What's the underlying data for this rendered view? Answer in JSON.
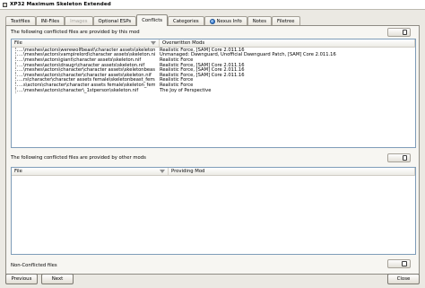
{
  "window": {
    "title": "XP32 Maximum Skeleton Extended"
  },
  "tabs": [
    {
      "label": "Textfiles",
      "disabled": false,
      "active": false
    },
    {
      "label": "INI-Files",
      "disabled": false,
      "active": false
    },
    {
      "label": "Images",
      "disabled": true,
      "active": false
    },
    {
      "label": "Optional ESPs",
      "disabled": false,
      "active": false
    },
    {
      "label": "Conflicts",
      "disabled": false,
      "active": true
    },
    {
      "label": "Categories",
      "disabled": false,
      "active": false
    },
    {
      "label": "Nexus Info",
      "disabled": false,
      "active": false,
      "icon": "globe-icon"
    },
    {
      "label": "Notes",
      "disabled": false,
      "active": false
    },
    {
      "label": "Filetree",
      "disabled": false,
      "active": false
    }
  ],
  "conflicts": {
    "provided_label": "The following conflicted files are provided by this mod",
    "provided_columns": {
      "file": "File",
      "overwritten": "Overwritten Mods"
    },
    "provided_rows": [
      {
        "file": "...\\meshes\\actors\\werewolfbeast\\character assets\\skeleton.nif",
        "mods": "Realistic Force, [SAM] Core 2.011.16"
      },
      {
        "file": "...\\meshes\\actors\\vampirelord\\character assets\\skeleton.nif",
        "mods": "Unmanaged: Dawnguard, Unofficial Dawnguard Patch, [SAM] Core 2.011.16"
      },
      {
        "file": "...\\meshes\\actors\\giant\\character assets\\skeleton.nif",
        "mods": "Realistic Force"
      },
      {
        "file": "...\\meshes\\actors\\draugr\\character assets\\skeleton.nif",
        "mods": "Realistic Force, [SAM] Core 2.011.16"
      },
      {
        "file": "...\\meshes\\actors\\character\\character assets\\skeletonbeast.nif",
        "mods": "Realistic Force, [SAM] Core 2.011.16"
      },
      {
        "file": "...\\meshes\\actors\\character\\character assets\\skeleton.nif",
        "mods": "Realistic Force, [SAM] Core 2.011.16"
      },
      {
        "file": "...rs\\character\\character assets female\\skeletonbeast_female.nif",
        "mods": "Realistic Force"
      },
      {
        "file": "...s\\actors\\character\\character assets female\\skeleton_female.nif",
        "mods": "Realistic Force"
      },
      {
        "file": "...\\meshes\\actors\\character\\_1stperson\\skeleton.nif",
        "mods": "The Joy of Perspective"
      }
    ],
    "other_label": "The following conflicted files are provided by other mods",
    "other_columns": {
      "file": "File",
      "providing": "Providing Mod"
    },
    "other_rows": [],
    "nonconflicted_label": "Non-Conflicted files"
  },
  "buttons": {
    "previous": "Previous",
    "next": "Next",
    "close": "Close"
  }
}
